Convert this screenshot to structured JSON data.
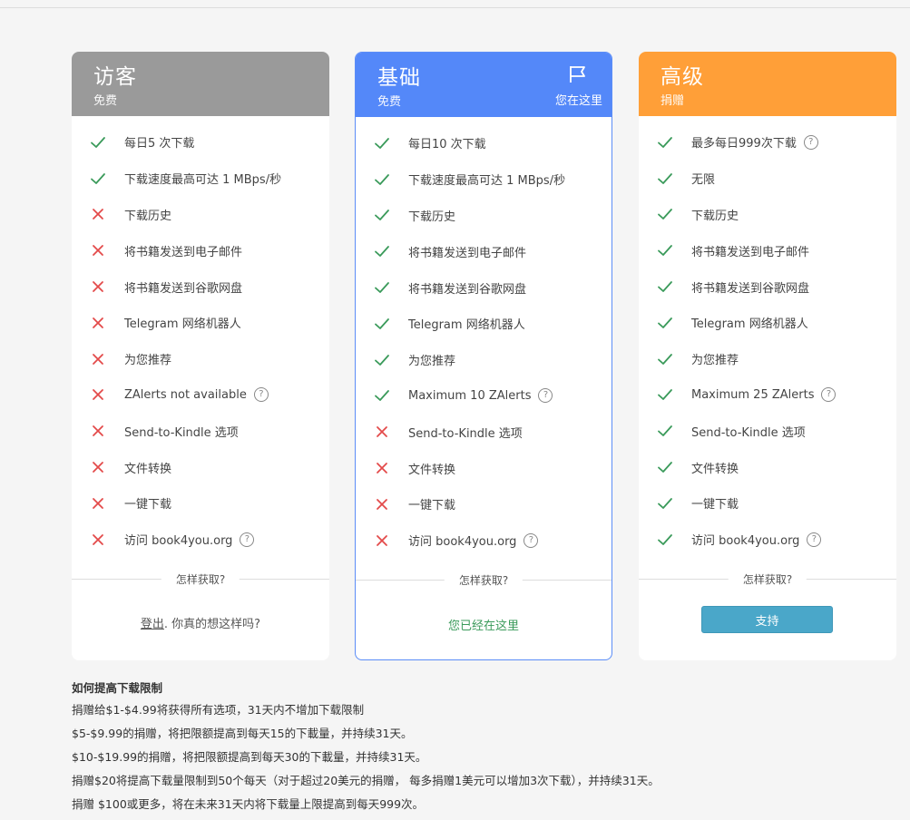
{
  "colors": {
    "check": "#3a9a5a",
    "cross": "#e34a4a",
    "guest_header": "#9a9a9a",
    "basic_header": "#5488f9",
    "premium_header": "#ff9f38",
    "support_button": "#4aa7c9"
  },
  "plans": [
    {
      "title": "访客",
      "subtitle": "免费",
      "features": [
        {
          "text": "每日5 次下载",
          "ok": true,
          "help": false
        },
        {
          "text": "下载速度最高可达 1 MBps/秒",
          "ok": true,
          "help": false
        },
        {
          "text": "下载历史",
          "ok": false,
          "help": false
        },
        {
          "text": "将书籍发送到电子邮件",
          "ok": false,
          "help": false
        },
        {
          "text": "将书籍发送到谷歌网盘",
          "ok": false,
          "help": false
        },
        {
          "text": "Telegram 网络机器人",
          "ok": false,
          "help": false
        },
        {
          "text": "为您推荐",
          "ok": false,
          "help": false
        },
        {
          "text": "ZAlerts not available",
          "ok": false,
          "help": true
        },
        {
          "text": "Send-to-Kindle 选项",
          "ok": false,
          "help": false
        },
        {
          "text": "文件转换",
          "ok": false,
          "help": false
        },
        {
          "text": "一键下载",
          "ok": false,
          "help": false
        },
        {
          "text": "访问 book4you.org",
          "ok": false,
          "help": true
        }
      ],
      "how_label": "怎样获取?",
      "footer_link": "登出",
      "footer_text": ". 你真的想这样吗?"
    },
    {
      "title": "基础",
      "subtitle": "免费",
      "here_label": "您在这里",
      "features": [
        {
          "text": "每日10 次下载",
          "ok": true,
          "help": false
        },
        {
          "text": "下载速度最高可达 1 MBps/秒",
          "ok": true,
          "help": false
        },
        {
          "text": "下载历史",
          "ok": true,
          "help": false
        },
        {
          "text": "将书籍发送到电子邮件",
          "ok": true,
          "help": false
        },
        {
          "text": "将书籍发送到谷歌网盘",
          "ok": true,
          "help": false
        },
        {
          "text": "Telegram 网络机器人",
          "ok": true,
          "help": false
        },
        {
          "text": "为您推荐",
          "ok": true,
          "help": false
        },
        {
          "text": "Maximum 10 ZAlerts",
          "ok": true,
          "help": true
        },
        {
          "text": "Send-to-Kindle 选项",
          "ok": false,
          "help": false
        },
        {
          "text": "文件转换",
          "ok": false,
          "help": false
        },
        {
          "text": "一键下载",
          "ok": false,
          "help": false
        },
        {
          "text": "访问 book4you.org",
          "ok": false,
          "help": true
        }
      ],
      "how_label": "怎样获取?",
      "footer_text": "您已经在这里"
    },
    {
      "title": "高级",
      "subtitle": "捐赠",
      "features": [
        {
          "text": "最多每日999次下载",
          "ok": true,
          "help": true
        },
        {
          "text": "无限",
          "ok": true,
          "help": false
        },
        {
          "text": "下载历史",
          "ok": true,
          "help": false
        },
        {
          "text": "将书籍发送到电子邮件",
          "ok": true,
          "help": false
        },
        {
          "text": "将书籍发送到谷歌网盘",
          "ok": true,
          "help": false
        },
        {
          "text": "Telegram 网络机器人",
          "ok": true,
          "help": false
        },
        {
          "text": "为您推荐",
          "ok": true,
          "help": false
        },
        {
          "text": "Maximum 25 ZAlerts",
          "ok": true,
          "help": true
        },
        {
          "text": "Send-to-Kindle 选项",
          "ok": true,
          "help": false
        },
        {
          "text": "文件转换",
          "ok": true,
          "help": false
        },
        {
          "text": "一键下载",
          "ok": true,
          "help": false
        },
        {
          "text": "访问 book4you.org",
          "ok": true,
          "help": true
        }
      ],
      "how_label": "怎样获取?",
      "button_label": "支持"
    }
  ],
  "info": {
    "heading": "如何提高下载限制",
    "lines": [
      "捐赠给$1-$4.99将获得所有选项，31天内不增加下载限制",
      "$5-$9.99的捐赠，将把限额提高到每天15的下載量，并持续31天。",
      "$10-$19.99的捐赠，将把限额提高到每天30的下載量，并持续31天。",
      "捐赠$20将提高下载量限制到50个每天（对于超过20美元的捐赠， 每多捐赠1美元可以增加3次下载），并持续31天。",
      "捐赠 $100或更多，将在未来31天内将下载量上限提高到每天999次。"
    ]
  }
}
